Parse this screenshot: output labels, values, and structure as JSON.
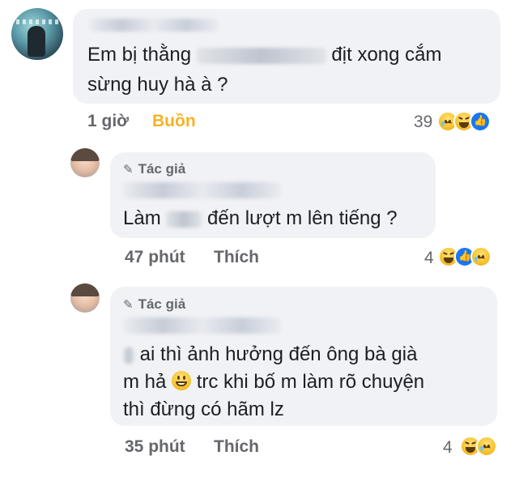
{
  "comments": [
    {
      "line1_pre": "Em bị thằng",
      "line1_post": "địt xong cắm",
      "line2": "sừng huy hà à ?",
      "time": "1 giờ",
      "action": "Buồn",
      "action_color": "#f7b125",
      "reaction_count": "39",
      "reactions": [
        "sad-icon",
        "haha-icon",
        "like-icon"
      ]
    },
    {
      "author_tag": "Tác giả",
      "line1_pre": "Làm",
      "line1_post": "đến lượt m lên tiếng ?",
      "time": "47 phút",
      "action": "Thích",
      "reaction_count": "4",
      "reactions": [
        "haha-icon",
        "like-icon",
        "sad-icon"
      ]
    },
    {
      "author_tag": "Tác giả",
      "line1": "ai thì ảnh hưởng đến ông bà già",
      "line2_pre": "m hả",
      "line2_post": "trc khi bố m làm rõ chuyện",
      "line3": "thì đừng có hãm lz",
      "time": "35 phút",
      "action": "Thích",
      "reaction_count": "4",
      "reactions": [
        "haha-icon",
        "sad-icon"
      ]
    }
  ]
}
